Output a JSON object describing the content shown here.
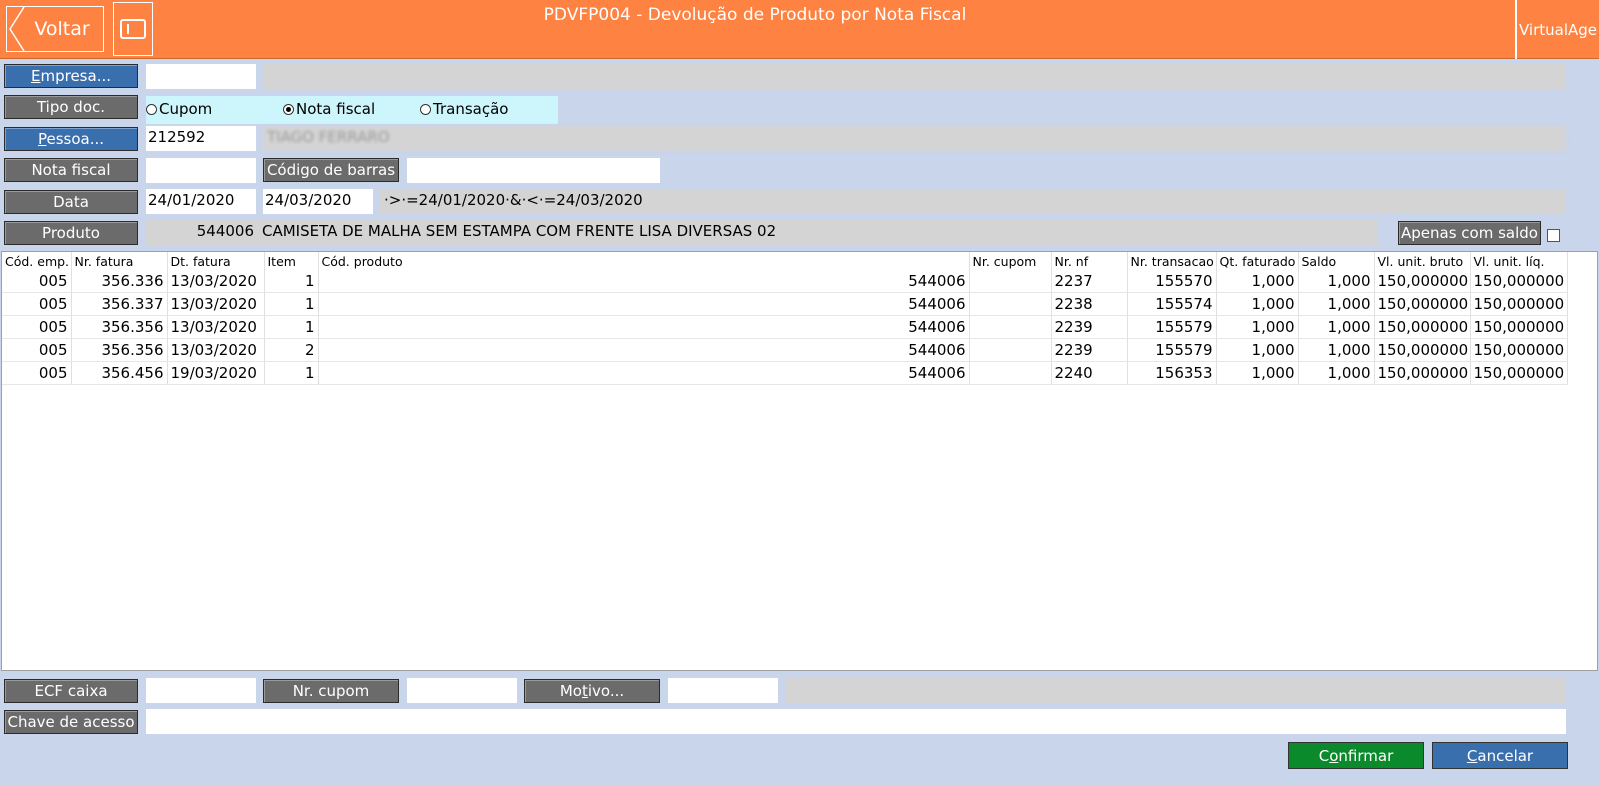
{
  "header": {
    "back_label": "Voltar",
    "title": "PDVFP004 - Devolução de Produto por Nota Fiscal",
    "brand": "VirtualAge",
    "color": "#fe8241"
  },
  "form": {
    "empresa_label": "Empresa...",
    "empresa_value": "",
    "tipo_doc_label": "Tipo doc.",
    "radio_options": [
      "Cupom",
      "Nota fiscal",
      "Transação"
    ],
    "radio_selected": "Nota fiscal",
    "pessoa_label": "Pessoa...",
    "pessoa_code": "212592",
    "pessoa_name": "TIAGO FERRARO",
    "nota_fiscal_label": "Nota fiscal",
    "nota_fiscal_value": "",
    "codigo_barras_label": "Código de barras",
    "codigo_barras_value": "",
    "data_label": "Data",
    "data_from": "24/01/2020",
    "data_to": "24/03/2020",
    "data_filter": "·>·=24/01/2020·&·<·=24/03/2020",
    "produto_label": "Produto",
    "produto_code": "544006",
    "produto_desc": "CAMISETA DE MALHA SEM ESTAMPA COM FRENTE LISA DIVERSAS 02",
    "apenas_saldo_label": "Apenas com saldo"
  },
  "table": {
    "columns": [
      "Cód. emp.",
      "Nr. fatura",
      "Dt. fatura",
      "Item",
      "Cód. produto",
      "Nr. cupom",
      "Nr. nf",
      "Nr. transacao",
      "Qt. faturado",
      "Saldo",
      "Vl. unit. bruto",
      "Vl. unit. líq."
    ],
    "rows": [
      [
        "005",
        "356.336",
        "13/03/2020",
        "1",
        "544006",
        "",
        "2237",
        "155570",
        "1,000",
        "1,000",
        "150,000000",
        "150,000000"
      ],
      [
        "005",
        "356.337",
        "13/03/2020",
        "1",
        "544006",
        "",
        "2238",
        "155574",
        "1,000",
        "1,000",
        "150,000000",
        "150,000000"
      ],
      [
        "005",
        "356.356",
        "13/03/2020",
        "1",
        "544006",
        "",
        "2239",
        "155579",
        "1,000",
        "1,000",
        "150,000000",
        "150,000000"
      ],
      [
        "005",
        "356.356",
        "13/03/2020",
        "2",
        "544006",
        "",
        "2239",
        "155579",
        "1,000",
        "1,000",
        "150,000000",
        "150,000000"
      ],
      [
        "005",
        "356.456",
        "19/03/2020",
        "1",
        "544006",
        "",
        "2240",
        "156353",
        "1,000",
        "1,000",
        "150,000000",
        "150,000000"
      ]
    ]
  },
  "bottom": {
    "ecf_caixa_label": "ECF caixa",
    "nr_cupom_label": "Nr. cupom",
    "motivo_label": "Motivo...",
    "chave_acesso_label": "Chave de acesso",
    "confirmar_label": "Confirmar",
    "cancelar_label": "Cancelar"
  }
}
